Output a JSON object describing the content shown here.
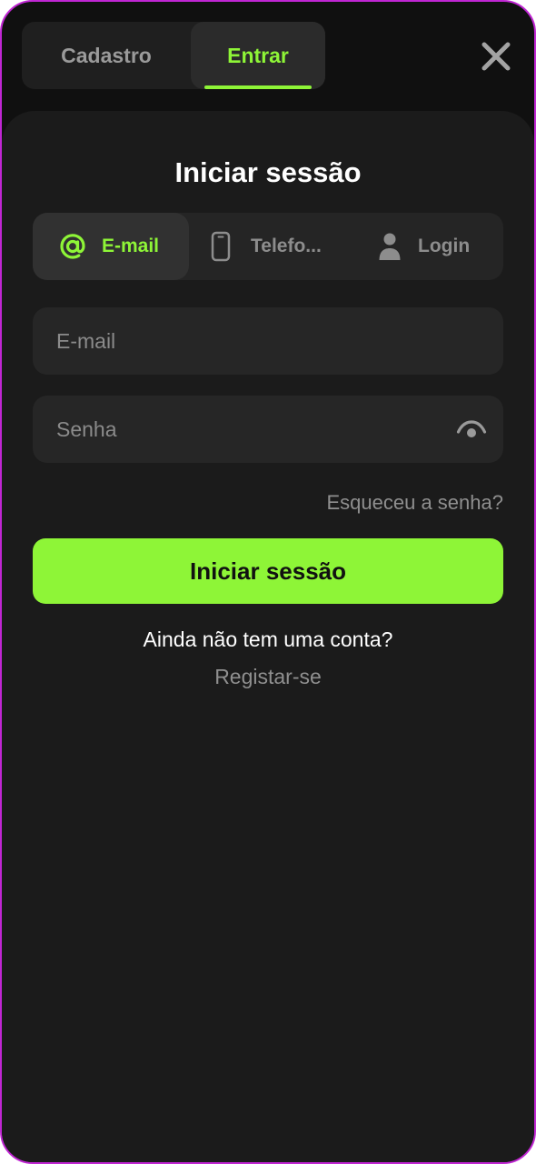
{
  "top_tabs": [
    {
      "label": "Cadastro",
      "active": false
    },
    {
      "label": "Entrar",
      "active": true
    }
  ],
  "close_icon": "close-icon",
  "title": "Iniciar sessão",
  "method_tabs": [
    {
      "label": "E-mail",
      "icon": "at-sign-icon",
      "active": true
    },
    {
      "label": "Telefo...",
      "icon": "smartphone-icon",
      "active": false
    },
    {
      "label": "Login",
      "icon": "user-icon",
      "active": false
    }
  ],
  "email_field": {
    "placeholder": "E-mail",
    "value": ""
  },
  "password_field": {
    "placeholder": "Senha",
    "value": "",
    "toggle_icon": "eye-icon"
  },
  "forgot_password": "Esqueceu a senha?",
  "submit_label": "Iniciar sessão",
  "no_account_text": "Ainda não tem uma conta?",
  "register_link": "Registar-se",
  "colors": {
    "accent": "#8ef537",
    "background": "#101010",
    "sheet": "#1b1b1b",
    "field": "#262626",
    "muted_text": "#8f8f8f"
  }
}
